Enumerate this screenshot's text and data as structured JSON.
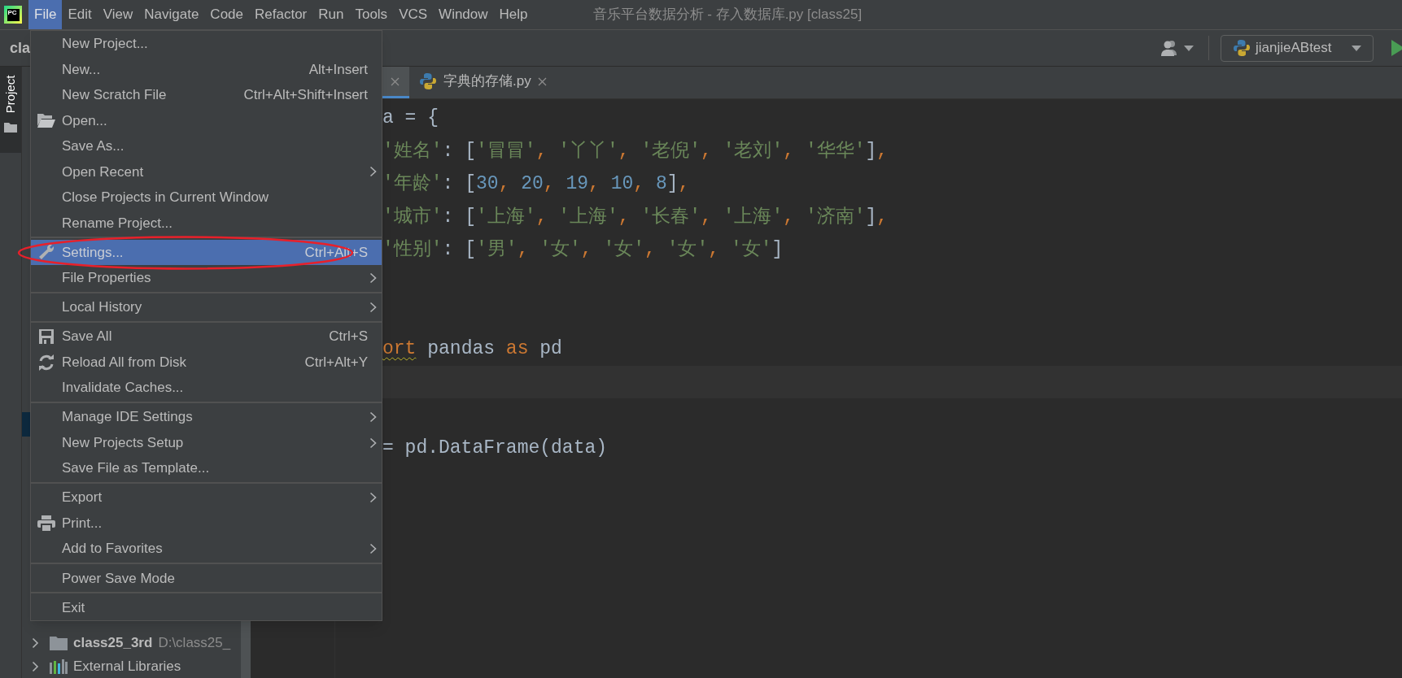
{
  "window": {
    "title": "音乐平台数据分析 - 存入数据库.py [class25]",
    "logo_text": "PC"
  },
  "menu_bar": [
    {
      "label": "File",
      "selected": true
    },
    {
      "label": "Edit",
      "selected": false
    },
    {
      "label": "View",
      "selected": false
    },
    {
      "label": "Navigate",
      "selected": false
    },
    {
      "label": "Code",
      "selected": false
    },
    {
      "label": "Refactor",
      "selected": false
    },
    {
      "label": "Run",
      "selected": false
    },
    {
      "label": "Tools",
      "selected": false
    },
    {
      "label": "VCS",
      "selected": false
    },
    {
      "label": "Window",
      "selected": false
    },
    {
      "label": "Help",
      "selected": false
    }
  ],
  "toolbar": {
    "project_name": "cla",
    "run_configuration": "jianjieABtest"
  },
  "tool_window_stripe": [
    {
      "label": "Project",
      "selected": true
    }
  ],
  "project_tree": [
    {
      "kind": "module",
      "label": "class25_3rd",
      "path": "D:\\class25_",
      "expanded": false
    },
    {
      "kind": "libraries",
      "label": "External Libraries",
      "expanded": false
    }
  ],
  "editor_tabs": [
    {
      "selected": true
    },
    {
      "label": "字典的存储.py",
      "selected": false
    }
  ],
  "code_lines": [
    {
      "kind": "code",
      "tokens": [
        {
          "kind": "plain",
          "text": "a = {"
        }
      ]
    },
    {
      "kind": "code",
      "tokens": [
        {
          "kind": "str",
          "text": "'姓名'"
        },
        {
          "kind": "plain",
          "text": ": ["
        },
        {
          "kind": "str",
          "text": "'冒冒'"
        },
        {
          "kind": "punct",
          "text": ", "
        },
        {
          "kind": "str",
          "text": "'丫丫'"
        },
        {
          "kind": "punct",
          "text": ", "
        },
        {
          "kind": "str",
          "text": "'老倪'"
        },
        {
          "kind": "punct",
          "text": ", "
        },
        {
          "kind": "str",
          "text": "'老刘'"
        },
        {
          "kind": "punct",
          "text": ", "
        },
        {
          "kind": "str",
          "text": "'华华'"
        },
        {
          "kind": "plain",
          "text": "]"
        },
        {
          "kind": "punct",
          "text": ","
        }
      ]
    },
    {
      "kind": "code",
      "tokens": [
        {
          "kind": "str",
          "text": "'年龄'"
        },
        {
          "kind": "plain",
          "text": ": ["
        },
        {
          "kind": "num",
          "text": "30"
        },
        {
          "kind": "punct",
          "text": ", "
        },
        {
          "kind": "num",
          "text": "20"
        },
        {
          "kind": "punct",
          "text": ", "
        },
        {
          "kind": "num",
          "text": "19"
        },
        {
          "kind": "punct",
          "text": ", "
        },
        {
          "kind": "num",
          "text": "10"
        },
        {
          "kind": "punct",
          "text": ", "
        },
        {
          "kind": "num",
          "text": "8"
        },
        {
          "kind": "plain",
          "text": "]"
        },
        {
          "kind": "punct",
          "text": ","
        }
      ]
    },
    {
      "kind": "code",
      "tokens": [
        {
          "kind": "str",
          "text": "'城市'"
        },
        {
          "kind": "plain",
          "text": ": ["
        },
        {
          "kind": "str",
          "text": "'上海'"
        },
        {
          "kind": "punct",
          "text": ", "
        },
        {
          "kind": "str",
          "text": "'上海'"
        },
        {
          "kind": "punct",
          "text": ", "
        },
        {
          "kind": "str",
          "text": "'长春'"
        },
        {
          "kind": "punct",
          "text": ", "
        },
        {
          "kind": "str",
          "text": "'上海'"
        },
        {
          "kind": "punct",
          "text": ", "
        },
        {
          "kind": "str",
          "text": "'济南'"
        },
        {
          "kind": "plain",
          "text": "]"
        },
        {
          "kind": "punct",
          "text": ","
        }
      ]
    },
    {
      "kind": "code",
      "tokens": [
        {
          "kind": "str",
          "text": "'性别'"
        },
        {
          "kind": "plain",
          "text": ": ["
        },
        {
          "kind": "str",
          "text": "'男'"
        },
        {
          "kind": "punct",
          "text": ", "
        },
        {
          "kind": "str",
          "text": "'女'"
        },
        {
          "kind": "punct",
          "text": ", "
        },
        {
          "kind": "str",
          "text": "'女'"
        },
        {
          "kind": "punct",
          "text": ", "
        },
        {
          "kind": "str",
          "text": "'女'"
        },
        {
          "kind": "punct",
          "text": ", "
        },
        {
          "kind": "str",
          "text": "'女'"
        },
        {
          "kind": "plain",
          "text": "]"
        }
      ]
    },
    {
      "kind": "blank"
    },
    {
      "kind": "blank"
    },
    {
      "kind": "code",
      "tokens": [
        {
          "kind": "kw",
          "text": "ort",
          "warning": true
        },
        {
          "kind": "plain",
          "text": " pandas "
        },
        {
          "kind": "kw",
          "text": "as"
        },
        {
          "kind": "plain",
          "text": " pd"
        }
      ]
    },
    {
      "kind": "caret_line"
    },
    {
      "kind": "blank"
    },
    {
      "kind": "code",
      "tokens": [
        {
          "kind": "plain",
          "text": "= pd.DataFrame(data)"
        }
      ]
    }
  ],
  "file_menu": {
    "items": [
      {
        "kind": "item",
        "label": "New Project...",
        "selected": false
      },
      {
        "kind": "item",
        "label": "New...",
        "shortcut": "Alt+Insert",
        "selected": false
      },
      {
        "kind": "item",
        "label": "New Scratch File",
        "shortcut": "Ctrl+Alt+Shift+Insert",
        "selected": false
      },
      {
        "kind": "open",
        "label": "Open...",
        "selected": false
      },
      {
        "kind": "item",
        "label": "Save As...",
        "selected": false
      },
      {
        "kind": "item",
        "label": "Open Recent",
        "submenu": true,
        "selected": false
      },
      {
        "kind": "item",
        "label": "Close Projects in Current Window",
        "selected": false
      },
      {
        "kind": "item",
        "label": "Rename Project...",
        "selected": false
      },
      {
        "kind": "separator"
      },
      {
        "kind": "settings",
        "label": "Settings...",
        "shortcut": "Ctrl+Alt+S",
        "selected": true
      },
      {
        "kind": "item",
        "label": "File Properties",
        "submenu": true,
        "selected": false
      },
      {
        "kind": "separator"
      },
      {
        "kind": "item",
        "label": "Local History",
        "submenu": true,
        "selected": false
      },
      {
        "kind": "separator"
      },
      {
        "kind": "save",
        "label": "Save All",
        "shortcut": "Ctrl+S",
        "selected": false
      },
      {
        "kind": "reload",
        "label": "Reload All from Disk",
        "shortcut": "Ctrl+Alt+Y",
        "selected": false
      },
      {
        "kind": "item",
        "label": "Invalidate Caches...",
        "selected": false
      },
      {
        "kind": "separator"
      },
      {
        "kind": "item",
        "label": "Manage IDE Settings",
        "submenu": true,
        "selected": false
      },
      {
        "kind": "item",
        "label": "New Projects Setup",
        "submenu": true,
        "selected": false
      },
      {
        "kind": "item",
        "label": "Save File as Template...",
        "selected": false
      },
      {
        "kind": "separator"
      },
      {
        "kind": "item",
        "label": "Export",
        "submenu": true,
        "selected": false
      },
      {
        "kind": "print",
        "label": "Print...",
        "selected": false
      },
      {
        "kind": "item",
        "label": "Add to Favorites",
        "submenu": true,
        "selected": false
      },
      {
        "kind": "separator"
      },
      {
        "kind": "item",
        "label": "Power Save Mode",
        "selected": false
      },
      {
        "kind": "separator"
      },
      {
        "kind": "item",
        "label": "Exit",
        "selected": false
      }
    ]
  },
  "annotation": {
    "kind": "ellipse"
  }
}
